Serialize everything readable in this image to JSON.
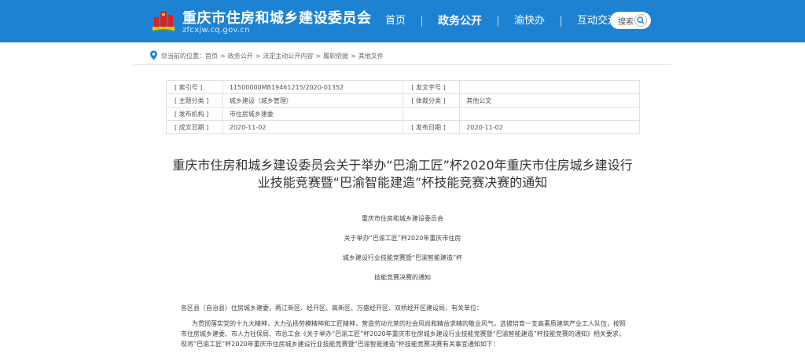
{
  "header": {
    "site_title": "重庆市住房和城乡建设委员会",
    "site_domain": "zfcxjw.cq.gov.cn",
    "nav": [
      "首页",
      "政务公开",
      "渝快办",
      "互动交流"
    ],
    "active_nav_index": 1,
    "search_label": "搜索",
    "colors": {
      "header_bg": "#1e82d2",
      "logo_red": "#d7261e",
      "logo_gold": "#f2c12e"
    }
  },
  "breadcrumb": {
    "prefix": "您当前的位置：",
    "items": [
      "首页",
      "政务公开",
      "法定主动公开内容",
      "履职依据",
      "其他文件"
    ],
    "separator": ">"
  },
  "info": {
    "rows": [
      {
        "l1": "[ 索引号 ]",
        "v1": "11500000MB19461215/2020-01352",
        "l2": "[ 发文字号 ]",
        "v2": ""
      },
      {
        "l1": "[ 主题分类 ]",
        "v1": "城乡建设（城乡管理）",
        "l2": "[ 体裁分类 ]",
        "v2": "其他公文"
      },
      {
        "l1": "[ 发布机构 ]",
        "v1": "市住房城乡建委",
        "l2": "",
        "v2": ""
      },
      {
        "l1": "[ 成文日期 ]",
        "v1": "2020-11-02",
        "l2": "[ 发布日期 ]",
        "v2": "2020-11-02"
      }
    ]
  },
  "article": {
    "title_line1": "重庆市住房和城乡建设委员会关于举办“巴渝工匠”杯2020年重庆市住房城乡建设行",
    "title_line2": "业技能竞赛暨“巴渝智能建造”杯技能竞赛决赛的通知",
    "heading_lines": [
      "重庆市住房和城乡建设委员会",
      "关于举办“巴渝工匠”杯2020年重庆市住房",
      "城乡建设行业技能竞赛暨“巴渝智能建造”杯",
      "技能竞赛决赛的通知"
    ],
    "salutation": "各区县（自治县）住房城乡建委，两江新区、经开区、高新区、万盛经开区、双桥经开区建设局，有关单位：",
    "paragraph1": "为贯彻落实党的十九大精神，大力弘扬劳模精神和工匠精神，营造劳动光荣的社会风尚和精益求精的敬业风气，选拔培育一支高素质建筑产业工人队伍，按照市住房城乡建委、市人力社保局、市总工会《关于举办“巴渝工匠”杯2020年重庆市住房城乡建设行业技能竞赛暨“巴渝智能建造”杯技能竞赛的通知》相关要求，现将“巴渝工匠”杯2020年重庆市住房城乡建设行业技能竞赛暨“巴渝智能建造”杯技能竞赛决赛有关事宜通知如下："
  }
}
